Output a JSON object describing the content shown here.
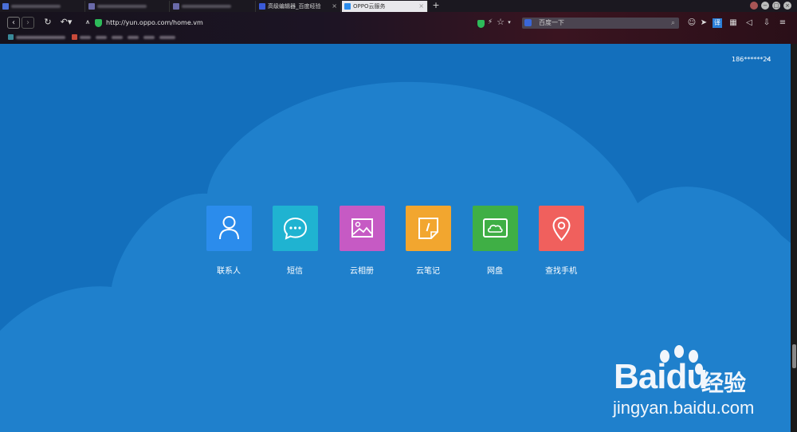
{
  "browser": {
    "tabs": [
      {
        "label": "",
        "blurred": true
      },
      {
        "label": "",
        "blurred": true
      },
      {
        "label": "",
        "blurred": true
      },
      {
        "label": "高级编辑器_百度经验",
        "blurred": false
      },
      {
        "label": "OPPO云服务",
        "blurred": false,
        "active": true
      }
    ],
    "new_tab": "+",
    "url": "http://yun.oppo.com/home.vm",
    "search_placeholder": "百度一下"
  },
  "page": {
    "account": "186******24",
    "apps": [
      {
        "label": "联系人",
        "icon": "contacts-icon",
        "color": "#2b8cec"
      },
      {
        "label": "短信",
        "icon": "message-icon",
        "color": "#1fb3d1"
      },
      {
        "label": "云相册",
        "icon": "photo-icon",
        "color": "#c65ac4"
      },
      {
        "label": "云笔记",
        "icon": "note-icon",
        "color": "#f2a62f"
      },
      {
        "label": "网盘",
        "icon": "cloud-disk-icon",
        "color": "#3faf45"
      },
      {
        "label": "查找手机",
        "icon": "location-icon",
        "color": "#f0605d"
      }
    ]
  },
  "watermark": {
    "brand": "Bai",
    "brand2": "du",
    "cn": "经验",
    "url": "jingyan.baidu.com"
  },
  "colors": {
    "background": "#136fbc",
    "cloud": "#1f80cc"
  }
}
